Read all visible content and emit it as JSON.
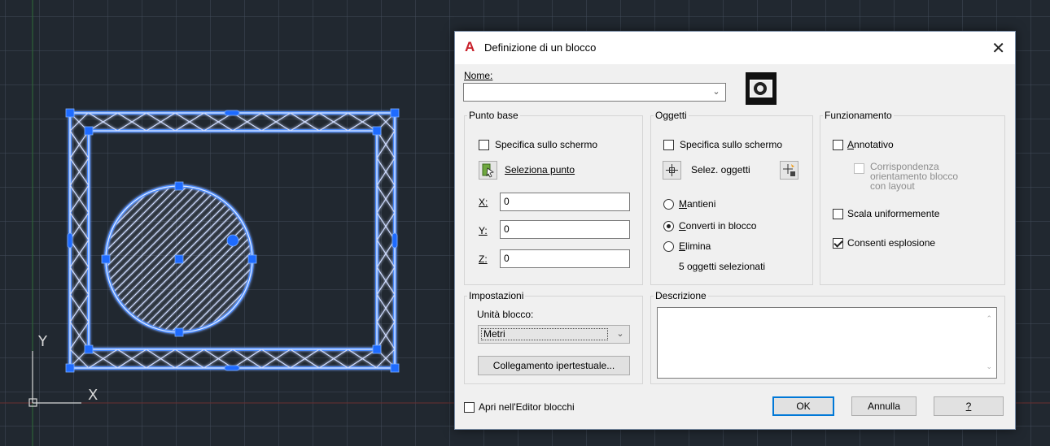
{
  "canvas": {
    "ucs_y_label": "Y",
    "ucs_x_label": "X",
    "colors": {
      "background": "#212830",
      "selection": "#4a8cff",
      "grip": "#1e6bff"
    }
  },
  "dialog": {
    "title": "Definizione di un blocco",
    "app_icon": "autocad-a-icon",
    "close_glyph": "✕",
    "name": {
      "label": "Nome:",
      "value": ""
    },
    "base_point": {
      "legend": "Punto base",
      "specify_on_screen": {
        "label": "Specifica sullo schermo",
        "checked": false
      },
      "pick_point_label": "Seleziona punto",
      "x": {
        "label": "X:",
        "value": "0"
      },
      "y": {
        "label": "Y:",
        "value": "0"
      },
      "z": {
        "label": "Z:",
        "value": "0"
      }
    },
    "objects": {
      "legend": "Oggetti",
      "specify_on_screen": {
        "label": "Specifica sullo schermo",
        "checked": false
      },
      "select_objects_label": "Selez. oggetti",
      "retain_label": "Mantieni",
      "convert_label": "Converti in blocco",
      "delete_label": "Elimina",
      "selected_option": "Converti in blocco",
      "status": "5 oggetti selezionati"
    },
    "behavior": {
      "legend": "Funzionamento",
      "annotative": {
        "label": "Annotativo",
        "checked": false
      },
      "match_orientation": {
        "label_line1": "Corrispondenza",
        "label_line2": "orientamento blocco",
        "label_line3": "con layout",
        "checked": false,
        "enabled": false
      },
      "scale_uniformly": {
        "label": "Scala uniformemente",
        "checked": false
      },
      "allow_exploding": {
        "label": "Consenti esplosione",
        "checked": true
      }
    },
    "settings": {
      "legend": "Impostazioni",
      "unit_label": "Unità blocco:",
      "unit_value": "Metri",
      "hyperlink_button": "Collegamento ipertestuale..."
    },
    "description": {
      "legend": "Descrizione",
      "value": ""
    },
    "open_in_editor": {
      "label": "Apri nell'Editor blocchi",
      "checked": false
    },
    "buttons": {
      "ok": "OK",
      "cancel": "Annulla",
      "help": "?"
    }
  }
}
